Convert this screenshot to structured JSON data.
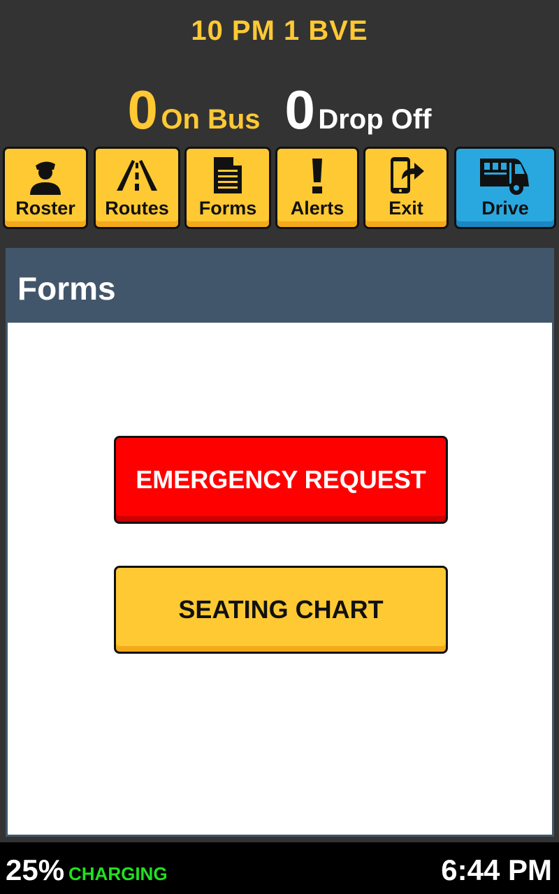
{
  "header": {
    "route_title": "10 PM 1 BVE",
    "on_bus_count": "0",
    "on_bus_label": "On Bus",
    "drop_off_count": "0",
    "drop_off_label": "Drop Off"
  },
  "toolbar": {
    "roster": {
      "label": "Roster",
      "icon": "driver-icon"
    },
    "routes": {
      "label": "Routes",
      "icon": "road-icon"
    },
    "forms": {
      "label": "Forms",
      "icon": "document-icon"
    },
    "alerts": {
      "label": "Alerts",
      "icon": "exclamation-icon"
    },
    "exit": {
      "label": "Exit",
      "icon": "phone-exit-icon"
    },
    "drive": {
      "label": "Drive",
      "icon": "bus-icon"
    }
  },
  "panel": {
    "title": "Forms",
    "emergency_label": "EMERGENCY REQUEST",
    "seating_label": "SEATING CHART"
  },
  "status": {
    "battery": "25%",
    "charging": "CHARGING",
    "time": "6:44 PM"
  },
  "colors": {
    "accent_yellow": "#ffc933",
    "drive_blue": "#29a8e0",
    "panel_header": "#42566b",
    "emergency_red": "#ff0000",
    "charging_green": "#22e022"
  }
}
